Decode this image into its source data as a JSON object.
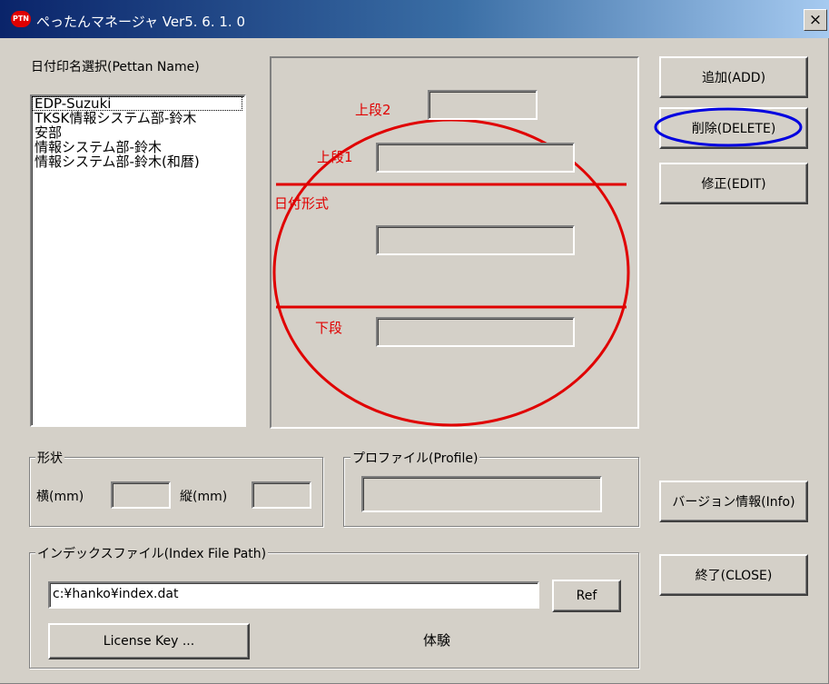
{
  "window": {
    "title": "ぺったんマネージャ Ver5. 6. 1. 0",
    "app_icon_text": "PTN",
    "close_label": "×"
  },
  "names": {
    "label": "日付印名選択(Pettan Name)",
    "items": [
      "EDP-Suzuki",
      "TKSK情報システム部-鈴木",
      "安部",
      "情報システム部-鈴木",
      "情報システム部-鈴木(和暦)"
    ]
  },
  "stamp": {
    "color": "#e00000",
    "upper2_label": "上段2",
    "upper1_label": "上段1",
    "date_format_label": "日付形式",
    "lower_label": "下段",
    "upper2_value": "",
    "upper1_value": "",
    "date_value": "",
    "lower_value": ""
  },
  "buttons": {
    "add": "追加(ADD)",
    "delete": "削除(DELETE)",
    "edit": "修正(EDIT)",
    "info": "バージョン情報(Info)",
    "close": "終了(CLOSE)",
    "ref": "Ref",
    "license": "License Key ..."
  },
  "annotation": {
    "color": "#0000e0"
  },
  "shape": {
    "title": "形状",
    "width_label": "横(mm)",
    "height_label": "縦(mm)",
    "width_value": "",
    "height_value": ""
  },
  "profile": {
    "title": "プロファイル(Profile)",
    "value": ""
  },
  "index": {
    "title": "インデックスファイル(Index File Path)",
    "path": "c:¥hanko¥index.dat",
    "mode": "体験"
  }
}
